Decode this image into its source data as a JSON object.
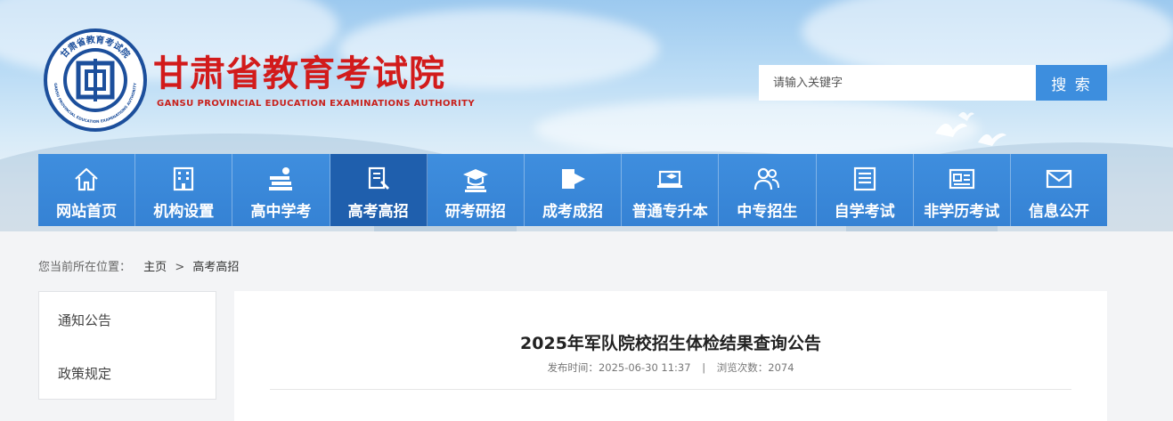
{
  "header": {
    "title": "甘肃省教育考试院",
    "subtitle": "GANSU PROVINCIAL EDUCATION EXAMINATIONS AUTHORITY",
    "seal_text_top": "甘肃省教育考试院",
    "seal_text_bottom": "GANSU PROVINCIAL EDUCATION EXAMINATIONS AUTHORITY"
  },
  "search": {
    "placeholder": "请输入关键字",
    "button_label": "搜 索"
  },
  "nav": {
    "items": [
      {
        "label": "网站首页",
        "icon": "home-icon"
      },
      {
        "label": "机构设置",
        "icon": "building-icon"
      },
      {
        "label": "高中学考",
        "icon": "books-icon"
      },
      {
        "label": "高考高招",
        "icon": "pen-paper-icon"
      },
      {
        "label": "研考研招",
        "icon": "graduation-cap-icon"
      },
      {
        "label": "成考成招",
        "icon": "book-arrow-icon"
      },
      {
        "label": "普通专升本",
        "icon": "laptop-cap-icon"
      },
      {
        "label": "中专招生",
        "icon": "users-icon"
      },
      {
        "label": "自学考试",
        "icon": "document-icon"
      },
      {
        "label": "非学历考试",
        "icon": "id-card-icon"
      },
      {
        "label": "信息公开",
        "icon": "mail-icon"
      }
    ],
    "active_index": 3
  },
  "breadcrumb": {
    "prefix": "您当前所在位置：",
    "home": "主页",
    "separator": ">",
    "current": "高考高招"
  },
  "sidebar": {
    "items": [
      "通知公告",
      "政策规定"
    ]
  },
  "article": {
    "title": "2025年军队院校招生体检结果查询公告",
    "publish_label": "发布时间：",
    "publish_time": "2025-06-30 11:37",
    "divider": "|",
    "views_label": "浏览次数：",
    "views": "2074"
  },
  "colors": {
    "brand_red": "#d21b1b",
    "nav_blue": "#3a86d8",
    "nav_active": "#1f5fad",
    "search_button": "#3d8ede"
  }
}
